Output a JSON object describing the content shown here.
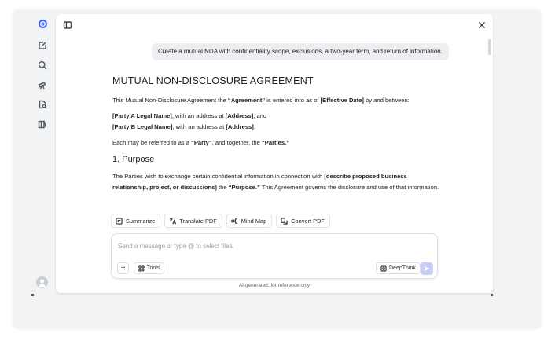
{
  "prompt": {
    "text": "Create a mutual NDA with confidentiality scope, exclusions, a two-year term, and return of information."
  },
  "document": {
    "title": "MUTUAL NON-DISCLOSURE AGREEMENT",
    "intro": {
      "t1": "This Mutual Non-Disclosure Agreement the ",
      "b1": "“Agreement”",
      "t2": " is entered into as of ",
      "b2": "[Effective Date]",
      "t3": " by and between:"
    },
    "party_a": {
      "b1": "[Party A Legal Name]",
      "t1": ", with an address at ",
      "b2": "[Address]",
      "t2": "; and"
    },
    "party_b": {
      "b1": "[Party B Legal Name]",
      "t1": ", with an address at ",
      "b2": "[Address]",
      "t2": "."
    },
    "each": {
      "t1": "Each may be referred to as a ",
      "b1": "“Party”",
      "t2": ", and together, the ",
      "b2": "“Parties.”"
    },
    "section1_heading": "1. Purpose",
    "purpose": {
      "t1": "The Parties wish to exchange certain confidential information in connection with ",
      "b1": "[describe proposed business relationship, project, or discussions]",
      "t2": " the ",
      "b2": "“Purpose.”",
      "t3": " This Agreement governs the disclosure and use of that information."
    }
  },
  "actions": {
    "summarize": "Summarize",
    "translate": "Translate PDF",
    "mindmap": "Mind Map",
    "convert": "Convert PDF"
  },
  "composer": {
    "placeholder": "Send a message or type @ to select files.",
    "tools_label": "Tools",
    "deepthink_label": "DeepThink",
    "plus_label": "+"
  },
  "disclaimer": "AI-generated, for reference only",
  "icons": {
    "logo": "logo-icon",
    "new_chat": "edit-icon",
    "search": "search-icon",
    "bookmarks": "telescope-icon",
    "files": "file-search-icon",
    "library": "library-icon"
  },
  "colors": {
    "send_button": "#c8cdf8",
    "logo": "#4d6bfe"
  }
}
